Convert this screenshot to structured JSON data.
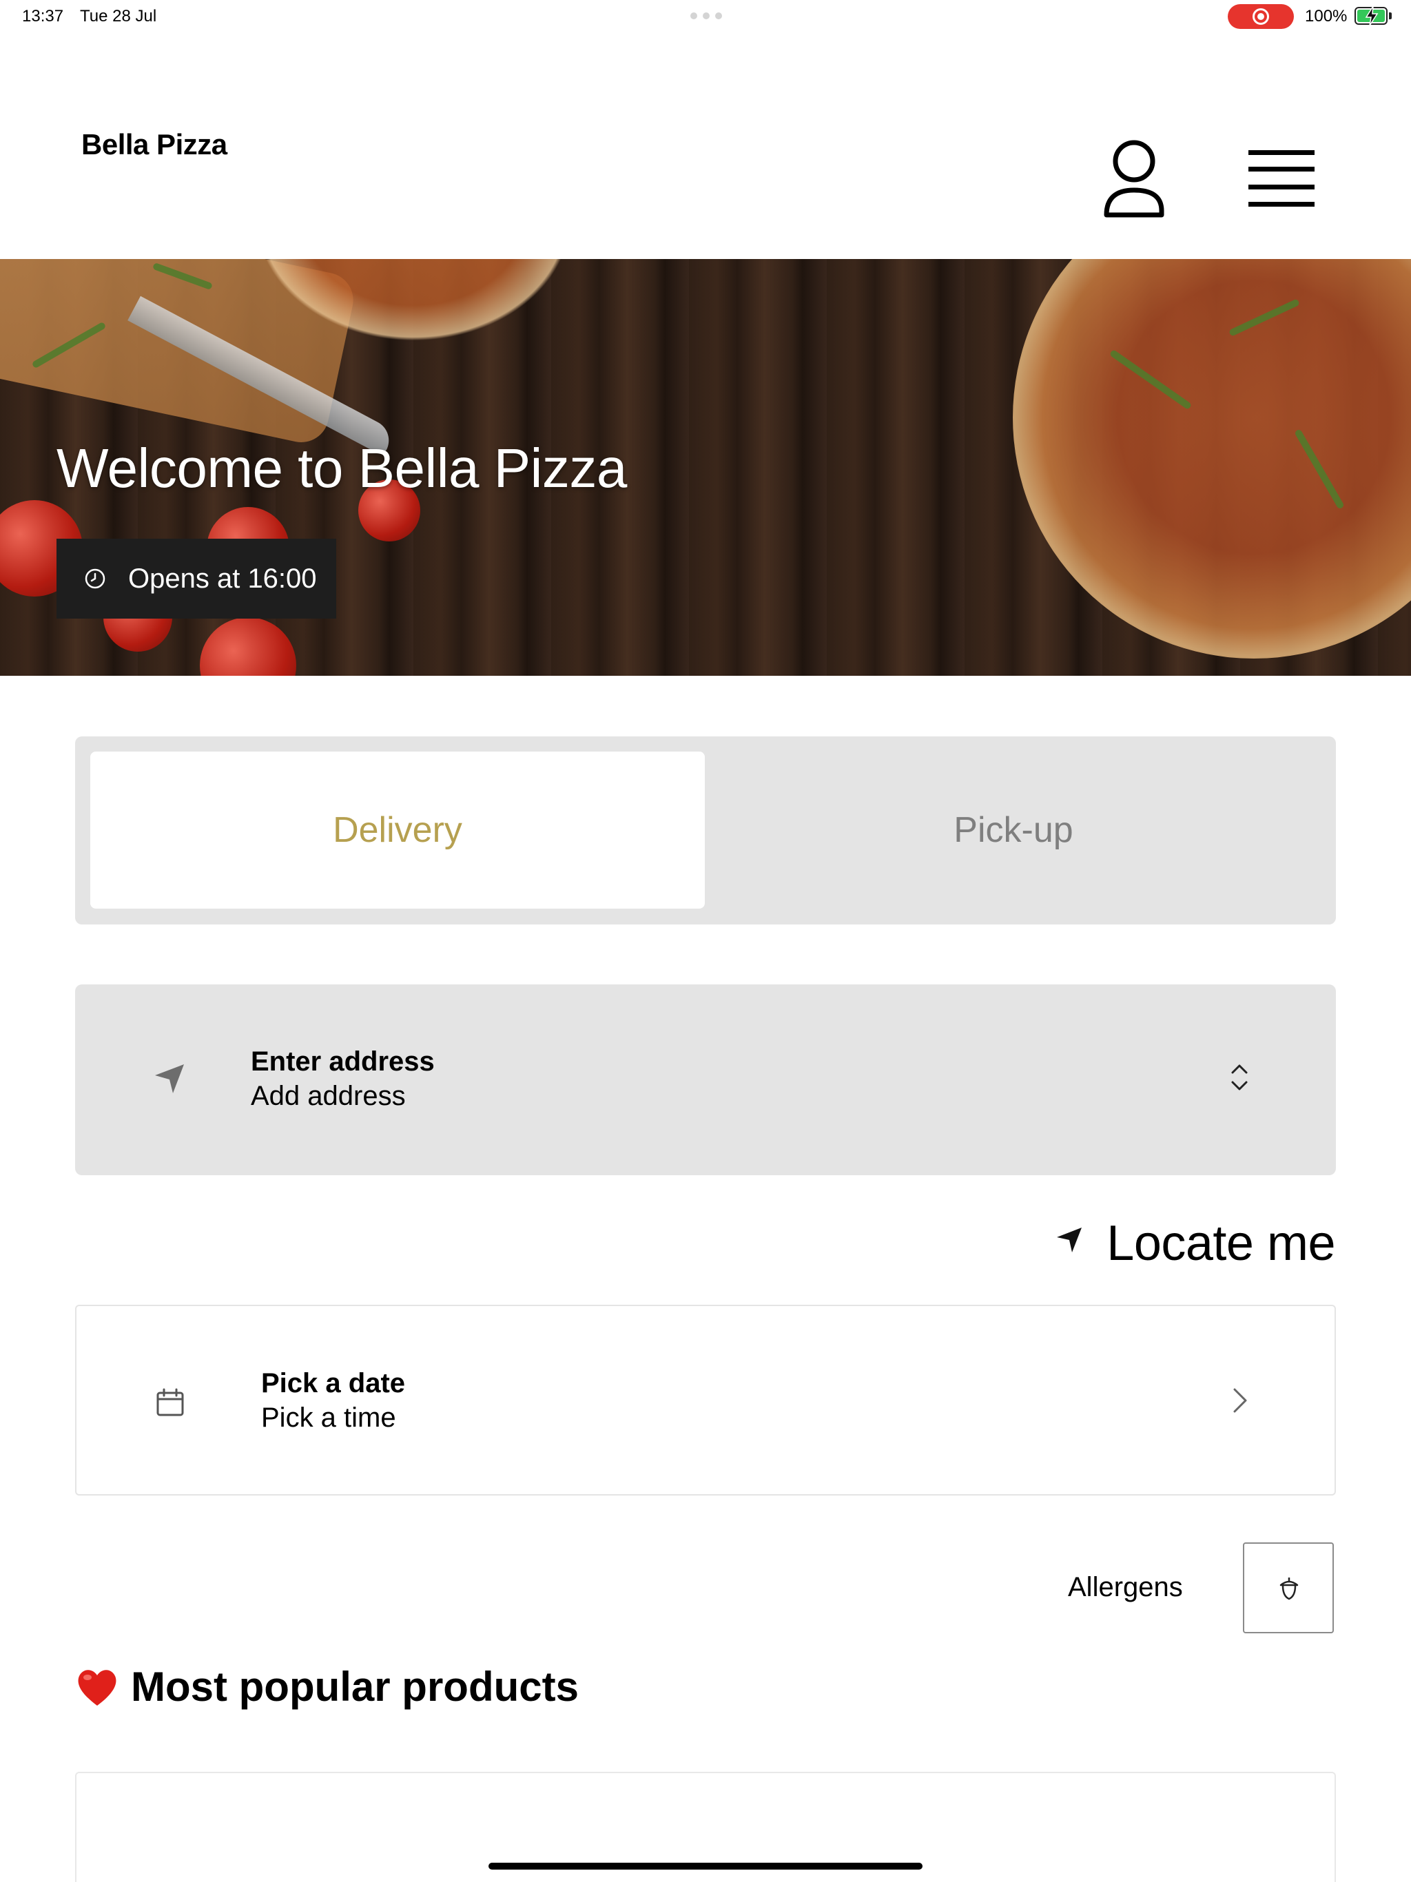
{
  "status_bar": {
    "time": "13:37",
    "date": "Tue 28 Jul",
    "battery_percent": "100%",
    "battery_level": 1.0,
    "recording_color": "#e6342d"
  },
  "header": {
    "brand": "Bella Pizza",
    "account_icon": "person-icon",
    "menu_icon": "hamburger-menu-icon"
  },
  "hero": {
    "title": "Welcome to Bella Pizza",
    "hours_icon": "clock-icon",
    "hours_text": "Opens at 16:00"
  },
  "order_mode": {
    "options": [
      "Delivery",
      "Pick-up"
    ],
    "selected": "Delivery",
    "active_color": "#b6a050",
    "inactive_color": "#7f7f7f"
  },
  "address": {
    "icon": "location-arrow-icon",
    "title": "Enter address",
    "subtitle": "Add address",
    "chevron": "chevron-up-down-icon"
  },
  "locate": {
    "icon": "location-arrow-icon",
    "label": "Locate me"
  },
  "schedule": {
    "icon": "calendar-icon",
    "title": "Pick a date",
    "subtitle": "Pick a time",
    "chevron": "chevron-right-icon"
  },
  "allergens": {
    "label": "Allergens",
    "icon": "acorn-icon"
  },
  "popular": {
    "emoji_icon": "heart-icon",
    "heading": "Most popular products"
  }
}
